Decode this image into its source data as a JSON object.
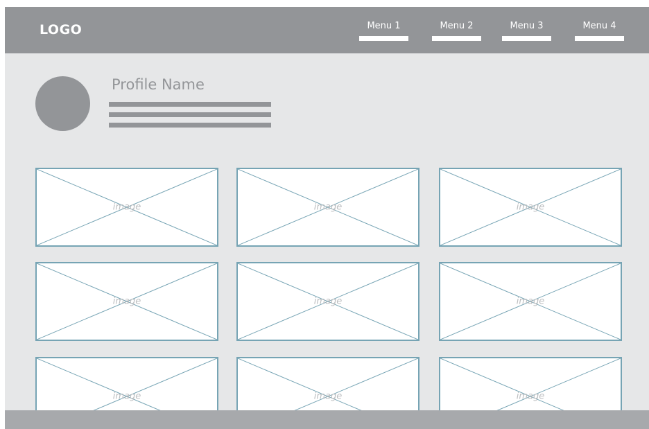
{
  "header": {
    "logo": "LOGO",
    "menu": [
      {
        "label": "Menu 1"
      },
      {
        "label": "Menu 2"
      },
      {
        "label": "Menu 3"
      },
      {
        "label": "Menu 4"
      }
    ]
  },
  "profile": {
    "name": "Profile Name"
  },
  "gallery": {
    "items": [
      {
        "label": "image"
      },
      {
        "label": "image"
      },
      {
        "label": "image"
      },
      {
        "label": "image"
      },
      {
        "label": "image"
      },
      {
        "label": "image"
      },
      {
        "label": "image"
      },
      {
        "label": "image"
      },
      {
        "label": "image"
      }
    ]
  },
  "colors": {
    "header_bg": "#939598",
    "page_bg": "#e6e7e8",
    "card_border": "#76a4b4",
    "footer_bg": "#a7a9ac"
  }
}
